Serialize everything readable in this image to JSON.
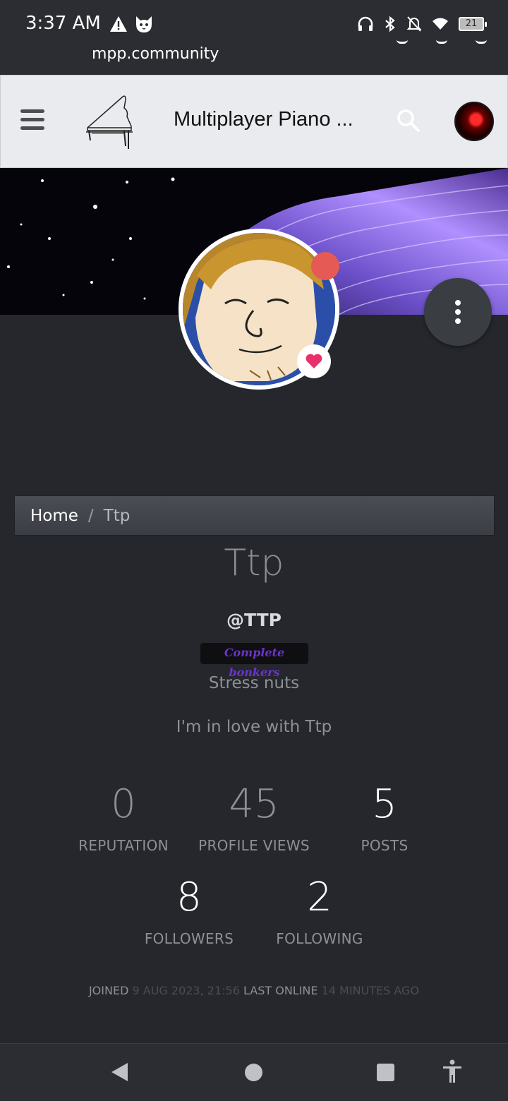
{
  "status_bar": {
    "time": "3:37 AM",
    "battery_level": "21",
    "icons": [
      "warning-icon",
      "cat-icon",
      "headphones-icon",
      "bluetooth-icon",
      "notifications-off-icon",
      "wifi-icon",
      "battery-icon"
    ]
  },
  "browser": {
    "url": "mpp.community"
  },
  "header": {
    "title": "Multiplayer Piano ...",
    "icons": [
      "menu-icon",
      "piano-logo",
      "search-icon",
      "user-avatar"
    ]
  },
  "breadcrumb": {
    "home": "Home",
    "separator": "/",
    "current": "Ttp"
  },
  "profile": {
    "display_name": "Ttp",
    "username": "@TTP",
    "badge": "Complete bonkers",
    "badge_color": "#6a34c8",
    "tagline": "Stress nuts",
    "about_me": "I'm in love with Ttp",
    "status_color": "#e55a54"
  },
  "stats": {
    "reputation": {
      "value": "0",
      "label": "REPUTATION"
    },
    "profile_views": {
      "value": "45",
      "label": "PROFILE VIEWS"
    },
    "posts": {
      "value": "5",
      "label": "POSTS"
    },
    "followers": {
      "value": "8",
      "label": "FOLLOWERS"
    },
    "following": {
      "value": "2",
      "label": "FOLLOWING"
    }
  },
  "meta": {
    "joined_label": "JOINED",
    "joined_value": "9 AUG 2023, 21:56",
    "last_online_label": "LAST ONLINE",
    "last_online_value": "14 MINUTES AGO"
  },
  "nav": {
    "icons": [
      "back-icon",
      "home-icon",
      "recents-icon",
      "accessibility-icon"
    ]
  }
}
